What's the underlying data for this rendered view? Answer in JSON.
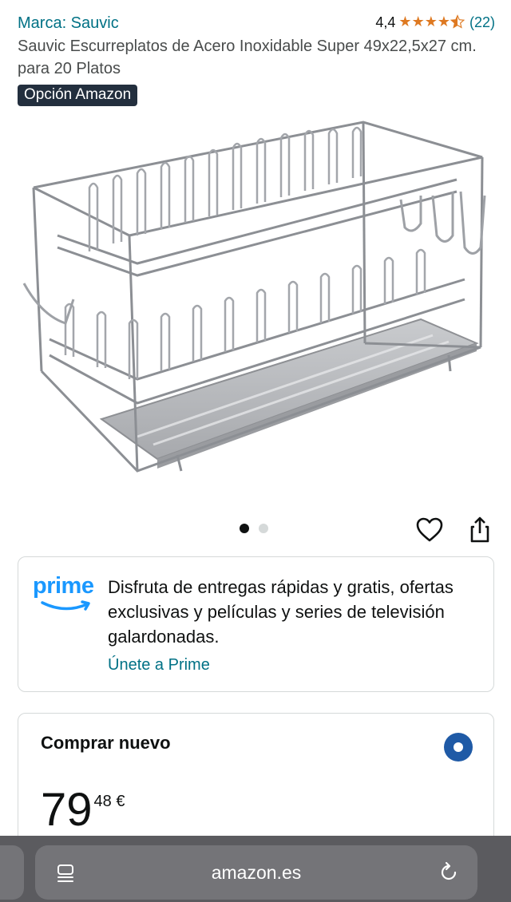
{
  "header": {
    "brand": "Marca: Sauvic",
    "rating_value": "4,4",
    "stars": 4.5,
    "review_count": "(22)",
    "title": "Sauvic Escurreplatos de Acero Inoxidable Super 49x22,5x27 cm. para 20 Platos",
    "badge": "Opción Amazon"
  },
  "gallery": {
    "image_icon": "dish-rack-image",
    "image_count": 2,
    "active_index": 0
  },
  "actions": {
    "favorite_icon": "heart-icon",
    "share_icon": "share-icon"
  },
  "prime": {
    "logo_text": "prime",
    "description": "Disfruta de entregas rápidas y gratis, ofertas exclusivas y películas y series de televisión galardonadas.",
    "link": "Únete a Prime",
    "color": "#1a98ff"
  },
  "buy_box": {
    "title": "Comprar nuevo",
    "price_whole": "79",
    "price_fraction": "48 €",
    "radio_selected": true
  },
  "browser": {
    "url": "amazon.es",
    "tabs_icon": "tabs-icon",
    "reload_icon": "reload-icon"
  },
  "colors": {
    "link": "#007185",
    "star": "#de7921",
    "badge_bg": "#232f3e",
    "radio": "#1f5aa6"
  }
}
